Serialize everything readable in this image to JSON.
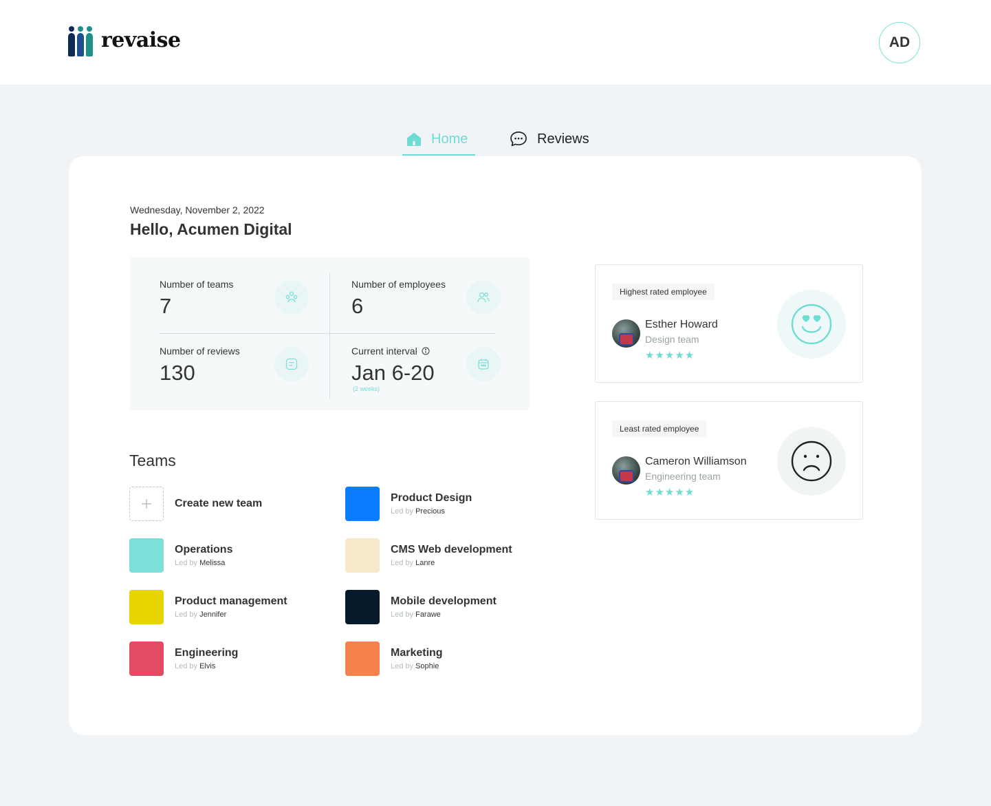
{
  "brand": {
    "name": "revaise",
    "colors": {
      "accent": "#6fdcd3",
      "navy": "#0f2b55",
      "teal": "#1f8f8c"
    }
  },
  "user": {
    "initials": "AD"
  },
  "nav": {
    "tabs": [
      {
        "label": "Home",
        "icon": "home-icon",
        "active": true
      },
      {
        "label": "Reviews",
        "icon": "chat-bubble-icon",
        "active": false
      }
    ]
  },
  "dashboard": {
    "date": "Wednesday, November 2, 2022",
    "greeting": "Hello, Acumen Digital",
    "stats": [
      {
        "label": "Number of teams",
        "value": "7",
        "icon": "teams-icon"
      },
      {
        "label": "Number of employees",
        "value": "6",
        "icon": "employees-icon"
      },
      {
        "label": "Number of reviews",
        "value": "130",
        "icon": "reviews-icon"
      },
      {
        "label": "Current interval",
        "value": "Jan 6-20",
        "sub": "(2 weeks)",
        "icon": "calendar-icon",
        "info_icon": "info-icon"
      }
    ]
  },
  "teams": {
    "title": "Teams",
    "create_label": "Create new team",
    "led_by_prefix": "Led by",
    "items": [
      {
        "name": "Product Design",
        "leader": "Precious",
        "color": "#0a7cff"
      },
      {
        "name": "Operations",
        "leader": "Melissa",
        "color": "#7ddfd9"
      },
      {
        "name": "CMS Web development",
        "leader": "Lanre",
        "color": "#f8e9cd"
      },
      {
        "name": "Product management",
        "leader": "Jennifer",
        "color": "#e6d500"
      },
      {
        "name": "Mobile development",
        "leader": "Farawe",
        "color": "#061a2c"
      },
      {
        "name": "Engineering",
        "leader": "Elvis",
        "color": "#e34a64"
      },
      {
        "name": "Marketing",
        "leader": "Sophie",
        "color": "#f5824a"
      }
    ]
  },
  "ratings": {
    "highest": {
      "tag": "Highest rated employee",
      "name": "Esther Howard",
      "team": "Design team",
      "stars": 5,
      "face": "happy-face-icon"
    },
    "least": {
      "tag": "Least rated employee",
      "name": "Cameron Williamson",
      "team": "Engineering team",
      "stars": 5,
      "face": "sad-face-icon"
    }
  }
}
